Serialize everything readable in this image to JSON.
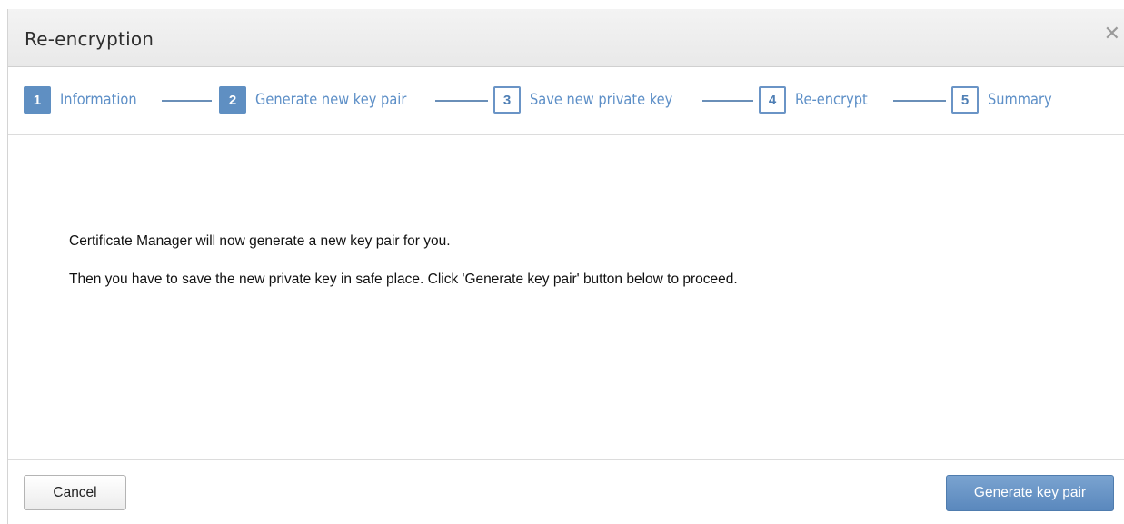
{
  "dialog": {
    "title": "Re-encryption",
    "close_icon": "close-icon",
    "close_glyph": "✕"
  },
  "wizard": {
    "steps": [
      {
        "number": "1",
        "label": "Information",
        "state": "active"
      },
      {
        "number": "2",
        "label": "Generate new key pair",
        "state": "active"
      },
      {
        "number": "3",
        "label": "Save new private key",
        "state": "pending"
      },
      {
        "number": "4",
        "label": "Re-encrypt",
        "state": "pending"
      },
      {
        "number": "5",
        "label": "Summary",
        "state": "pending"
      }
    ]
  },
  "content": {
    "line1": "Certificate Manager will now generate a new key pair for you.",
    "line2": "Then you have to save the new private key in safe place. Click 'Generate key pair' button below to proceed."
  },
  "footer": {
    "cancel_label": "Cancel",
    "generate_label": "Generate key pair"
  },
  "colors": {
    "accent": "#5f8fc2",
    "step_text": "#5d8fc7",
    "primary_button": "#6a96c8"
  }
}
